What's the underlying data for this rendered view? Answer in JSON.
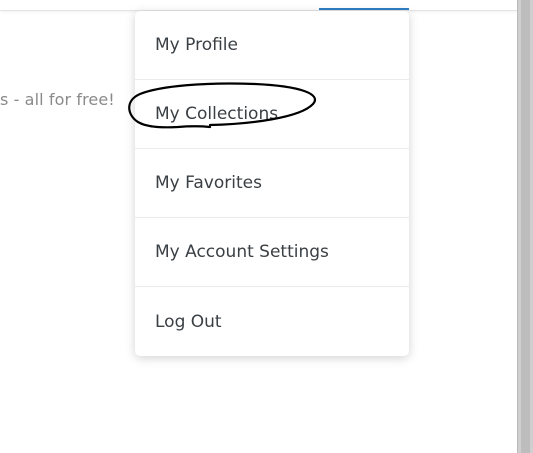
{
  "background_text": {
    "tagline": "s - all for free!"
  },
  "menu": {
    "items": [
      {
        "label": "My Profile"
      },
      {
        "label": "My Collections"
      },
      {
        "label": "My Favorites"
      },
      {
        "label": "My Account Settings"
      },
      {
        "label": "Log Out"
      }
    ]
  },
  "colors": {
    "accent_underline": "#2f7fc6",
    "menu_text": "#3a3f44",
    "muted_text": "#8a8a8a",
    "annotation_ink": "#000000"
  }
}
